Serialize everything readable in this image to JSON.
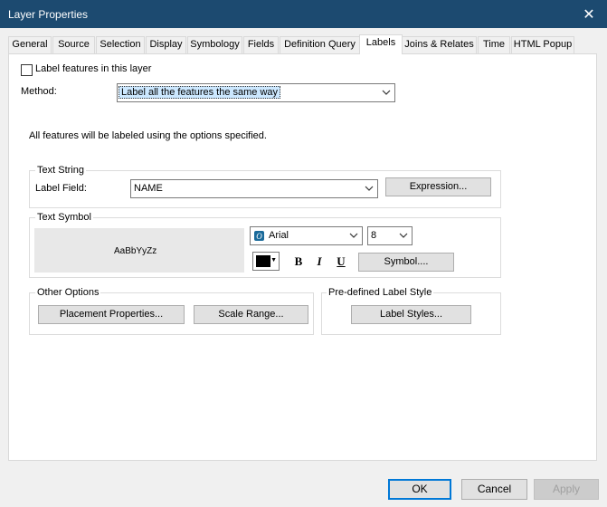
{
  "window": {
    "title": "Layer Properties",
    "close_glyph": "✕"
  },
  "tabs": [
    {
      "label": "General"
    },
    {
      "label": "Source"
    },
    {
      "label": "Selection"
    },
    {
      "label": "Display"
    },
    {
      "label": "Symbology"
    },
    {
      "label": "Fields"
    },
    {
      "label": "Definition Query"
    },
    {
      "label": "Labels"
    },
    {
      "label": "Joins & Relates"
    },
    {
      "label": "Time"
    },
    {
      "label": "HTML Popup"
    }
  ],
  "active_tab": "Labels",
  "labels": {
    "label_features_checkbox": {
      "label": "Label features in this layer",
      "checked": false
    },
    "method": {
      "label": "Method:",
      "value": "Label all the features the same way"
    },
    "description": "All features will be labeled using the options specified.",
    "text_string": {
      "legend": "Text String",
      "label_field_label": "Label Field:",
      "label_field_value": "NAME",
      "expression_button": "Expression..."
    },
    "text_symbol": {
      "legend": "Text Symbol",
      "preview_text": "AaBbYyZz",
      "font_value": "Arial",
      "size_value": "8",
      "bold": "B",
      "italic": "I",
      "underline": "U",
      "symbol_button": "Symbol....",
      "color": "#000000"
    },
    "other_options": {
      "legend": "Other Options",
      "placement_button": "Placement Properties...",
      "scale_range_button": "Scale Range..."
    },
    "predefined": {
      "legend": "Pre-defined Label Style",
      "label_styles_button": "Label Styles..."
    }
  },
  "footer": {
    "ok": "OK",
    "cancel": "Cancel",
    "apply": "Apply"
  },
  "colors": {
    "titlebar": "#1c4a70",
    "focus": "#0078d7"
  }
}
